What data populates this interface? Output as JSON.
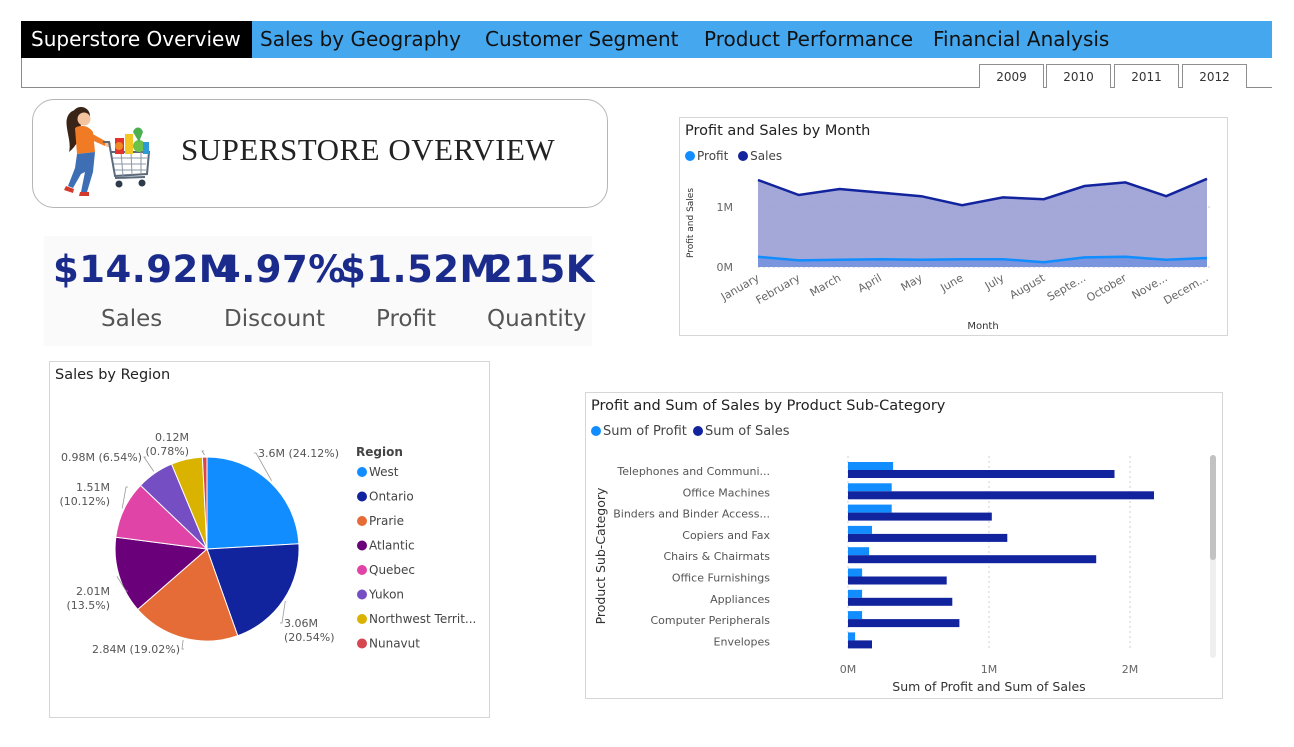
{
  "nav": {
    "tabs": [
      {
        "label": "Superstore Overview",
        "active": true
      },
      {
        "label": "Sales by Geography",
        "active": false
      },
      {
        "label": "Customer Segment",
        "active": false
      },
      {
        "label": "Product Performance",
        "active": false
      },
      {
        "label": "Financial Analysis",
        "active": false
      }
    ],
    "years": [
      "2009",
      "2010",
      "2011",
      "2012"
    ]
  },
  "title_card": {
    "title": "SUPERSTORE OVERVIEW",
    "illustration": "shopper-with-cart-icon"
  },
  "kpis": [
    {
      "value": "$14.92M",
      "label": "Sales"
    },
    {
      "value": "4.97%",
      "label": "Discount"
    },
    {
      "value": "$1.52M",
      "label": "Profit"
    },
    {
      "value": "215K",
      "label": "Quantity"
    }
  ],
  "colors": {
    "nav_bg": "#45a7ee",
    "kpi_text": "#1a2b8c",
    "profit": "#118dff",
    "sales": "#12239e",
    "sales_area": "#9ea3d6"
  },
  "chart_data": [
    {
      "type": "area",
      "title": "Profit and Sales by Month",
      "xlabel": "Month",
      "ylabel": "Profit and Sales",
      "categories": [
        "January",
        "February",
        "March",
        "April",
        "May",
        "June",
        "July",
        "August",
        "Septe...",
        "October",
        "Nove...",
        "Decem..."
      ],
      "series": [
        {
          "name": "Profit",
          "values": [
            0.17,
            0.11,
            0.12,
            0.13,
            0.12,
            0.13,
            0.13,
            0.08,
            0.16,
            0.17,
            0.12,
            0.15
          ]
        },
        {
          "name": "Sales",
          "values": [
            1.45,
            1.2,
            1.3,
            1.24,
            1.18,
            1.03,
            1.16,
            1.13,
            1.35,
            1.41,
            1.18,
            1.47
          ]
        }
      ],
      "yticks": [
        "0M",
        "1M"
      ],
      "ylim": [
        0,
        1.6
      ],
      "unit": "M",
      "legend_position": "top-left",
      "grid": true
    },
    {
      "type": "pie",
      "title": "Sales by Region",
      "legend_title": "Region",
      "legend_position": "right",
      "slices": [
        {
          "name": "West",
          "value": 3.6,
          "percent": 24.12,
          "label": "3.6M (24.12%)",
          "color": "#118dff"
        },
        {
          "name": "Ontario",
          "value": 3.06,
          "percent": 20.54,
          "label": "3.06M (20.54%)",
          "color": "#12239e"
        },
        {
          "name": "Prarie",
          "value": 2.84,
          "percent": 19.02,
          "label": "2.84M (19.02%)",
          "color": "#e66c37"
        },
        {
          "name": "Atlantic",
          "value": 2.01,
          "percent": 13.5,
          "label": "2.01M (13.5%)",
          "color": "#6b007b"
        },
        {
          "name": "Quebec",
          "value": 1.51,
          "percent": 10.12,
          "label": "1.51M (10.12%)",
          "color": "#e044a7"
        },
        {
          "name": "Yukon",
          "value": 0.98,
          "percent": 6.54,
          "label": "0.98M (6.54%)",
          "color": "#744ec2"
        },
        {
          "name": "Northwest Territ...",
          "value": 0.82,
          "percent": 5.38,
          "label": "",
          "color": "#d9b300"
        },
        {
          "name": "Nunavut",
          "value": 0.12,
          "percent": 0.78,
          "label": "0.12M (0.78%)",
          "color": "#d64550"
        }
      ]
    },
    {
      "type": "bar",
      "orientation": "horizontal",
      "title": "Profit and Sum of Sales by Product Sub-Category",
      "xlabel": "Sum of Profit and Sum of Sales",
      "ylabel": "Product Sub-Category",
      "categories": [
        "Telephones and Communi...",
        "Office Machines",
        "Binders and Binder Access...",
        "Copiers and Fax",
        "Chairs & Chairmats",
        "Office Furnishings",
        "Appliances",
        "Computer Peripherals",
        "Envelopes"
      ],
      "series": [
        {
          "name": "Sum of Profit",
          "values": [
            0.32,
            0.31,
            0.31,
            0.17,
            0.15,
            0.1,
            0.1,
            0.1,
            0.05
          ]
        },
        {
          "name": "Sum of Sales",
          "values": [
            1.89,
            2.17,
            1.02,
            1.13,
            1.76,
            0.7,
            0.74,
            0.79,
            0.17
          ]
        }
      ],
      "xticks": [
        "0M",
        "1M",
        "2M"
      ],
      "xlim": [
        0,
        2.3
      ],
      "unit": "M",
      "legend_position": "top-left",
      "grid": true
    }
  ]
}
